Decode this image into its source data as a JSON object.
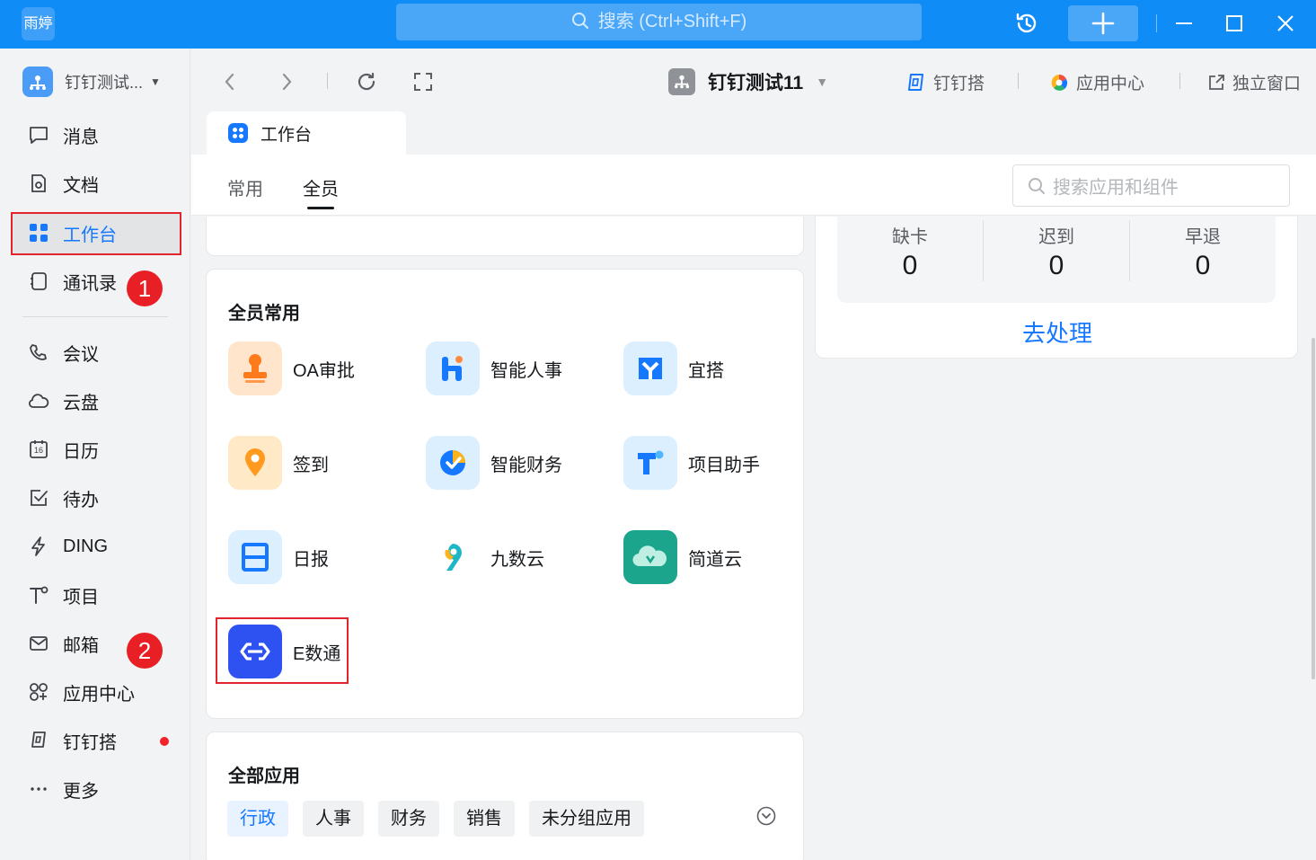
{
  "titlebar": {
    "user_avatar_text": "雨婷",
    "search_placeholder": "搜索 (Ctrl+Shift+F)",
    "accent_color": "#0f8cf5"
  },
  "sidebar": {
    "org_name": "钉钉测试...",
    "items": [
      {
        "label": "消息",
        "icon": "message-icon"
      },
      {
        "label": "文档",
        "icon": "document-icon"
      },
      {
        "label": "工作台",
        "icon": "workbench-icon",
        "active": true
      },
      {
        "label": "通讯录",
        "icon": "contacts-icon"
      },
      {
        "label": "会议",
        "icon": "meeting-icon"
      },
      {
        "label": "云盘",
        "icon": "cloud-drive-icon"
      },
      {
        "label": "日历",
        "icon": "calendar-icon",
        "icon_text": "16"
      },
      {
        "label": "待办",
        "icon": "todo-icon"
      },
      {
        "label": "DING",
        "icon": "ding-icon"
      },
      {
        "label": "项目",
        "icon": "project-icon"
      },
      {
        "label": "邮箱",
        "icon": "mail-icon"
      },
      {
        "label": "应用中心",
        "icon": "app-center-icon"
      },
      {
        "label": "钉钉搭",
        "icon": "dingda-icon"
      },
      {
        "label": "更多",
        "icon": "more-icon"
      }
    ],
    "annotations": [
      "1",
      "2"
    ]
  },
  "toolbar": {
    "org_name": "钉钉测试11",
    "links": [
      {
        "label": "钉钉搭",
        "icon": "dingda-icon"
      },
      {
        "label": "应用中心",
        "icon": "app-center-icon"
      },
      {
        "label": "独立窗口",
        "icon": "new-window-icon"
      }
    ]
  },
  "tab": {
    "label": "工作台"
  },
  "subnav": {
    "tabs": [
      {
        "label": "常用"
      },
      {
        "label": "全员",
        "active": true
      }
    ],
    "search_placeholder": "搜索应用和组件"
  },
  "common_apps": {
    "title": "全员常用",
    "apps": [
      {
        "label": "OA审批",
        "icon": "oa-approval-icon",
        "color": "#ff8c3a"
      },
      {
        "label": "智能人事",
        "icon": "smart-hr-icon",
        "color": "#1677ff"
      },
      {
        "label": "宜搭",
        "icon": "yida-icon",
        "color": "#1677ff"
      },
      {
        "label": "签到",
        "icon": "checkin-icon",
        "color": "#ff9a1f"
      },
      {
        "label": "智能财务",
        "icon": "smart-finance-icon",
        "color": "#1677ff"
      },
      {
        "label": "项目助手",
        "icon": "project-assistant-icon",
        "color": "#1677ff"
      },
      {
        "label": "日报",
        "icon": "daily-report-icon",
        "color": "#1677ff"
      },
      {
        "label": "九数云",
        "icon": "jiushuyun-icon",
        "color": "#1fb6c6"
      },
      {
        "label": "简道云",
        "icon": "jiandaoyun-icon",
        "color": "#1aa58c"
      },
      {
        "label": "E数通",
        "icon": "eshutong-icon",
        "color": "#2e52f2"
      }
    ]
  },
  "all_apps": {
    "title": "全部应用",
    "categories": [
      {
        "label": "行政",
        "active": true
      },
      {
        "label": "人事"
      },
      {
        "label": "财务"
      },
      {
        "label": "销售"
      },
      {
        "label": "未分组应用"
      }
    ]
  },
  "attendance": {
    "stats": [
      {
        "label": "缺卡",
        "value": "0"
      },
      {
        "label": "迟到",
        "value": "0"
      },
      {
        "label": "早退",
        "value": "0"
      }
    ],
    "action_label": "去处理"
  }
}
